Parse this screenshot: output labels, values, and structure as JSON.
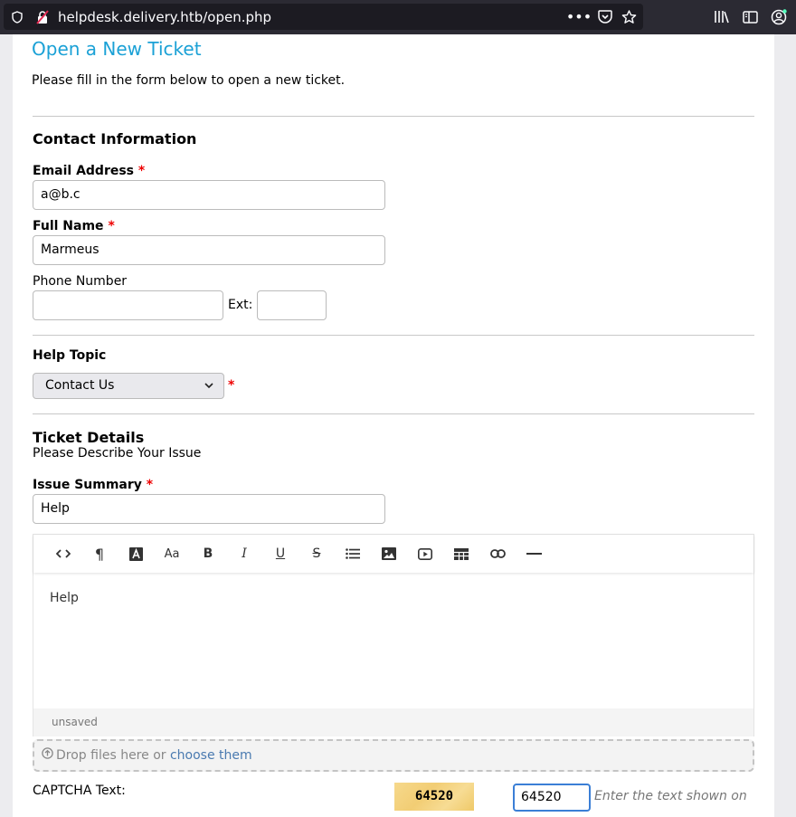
{
  "browser": {
    "url_host": "helpdesk.delivery.htb",
    "url_path": "/open.php"
  },
  "page": {
    "title": "Open a New Ticket",
    "intro": "Please fill in the form below to open a new ticket."
  },
  "contact": {
    "heading": "Contact Information",
    "email_label": "Email Address",
    "email_value": "a@b.c",
    "name_label": "Full Name",
    "name_value": "Marmeus",
    "phone_label": "Phone Number",
    "phone_value": "",
    "ext_label": "Ext:",
    "ext_value": "",
    "required_mark": "*"
  },
  "topic": {
    "heading": "Help Topic",
    "selected": "Contact Us",
    "required_mark": "*"
  },
  "details": {
    "heading": "Ticket Details",
    "subheading": "Please Describe Your Issue",
    "summary_label": "Issue Summary",
    "summary_value": "Help",
    "required_mark": "*"
  },
  "editor": {
    "body": "Help",
    "status": "unsaved",
    "toolbar_icons": [
      "code-view-icon",
      "paragraph-icon",
      "text-color-icon",
      "font-size-icon",
      "bold-icon",
      "italic-icon",
      "underline-icon",
      "strikethrough-icon",
      "list-icon",
      "image-icon",
      "video-icon",
      "table-icon",
      "link-icon",
      "horizontal-rule-icon"
    ]
  },
  "dropzone": {
    "text": "Drop files here or",
    "link": "choose them"
  },
  "captcha": {
    "label": "CAPTCHA Text:",
    "image_text": "64520",
    "value": "64520",
    "hint": "Enter the text shown on"
  }
}
